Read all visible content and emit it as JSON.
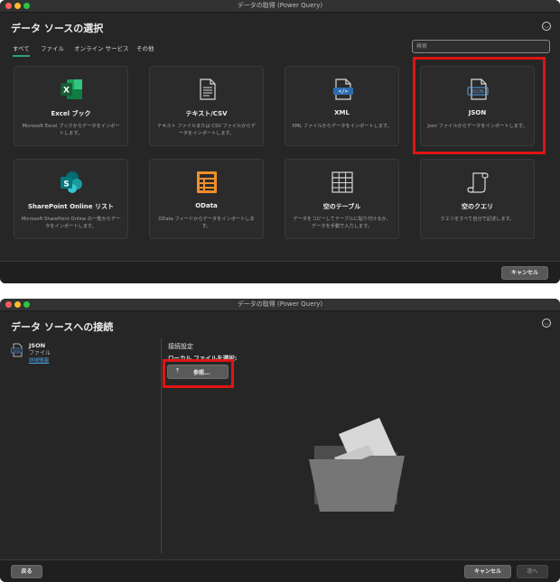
{
  "window1": {
    "title": "データの取得 (Power Query)",
    "heading": "データ ソースの選択",
    "tabs": [
      "すべて",
      "ファイル",
      "オンライン サービス",
      "その他"
    ],
    "active_tab": "すべて",
    "search_placeholder": "検索",
    "cards": [
      {
        "name": "Excel ブック",
        "desc": "Microsoft Excel ブックからデータをインポートします。",
        "icon": "excel-icon"
      },
      {
        "name": "テキスト/CSV",
        "desc": "テキスト ファイルまたは CSV ファイルからデータをインポートします。",
        "icon": "text-file-icon"
      },
      {
        "name": "XML",
        "desc": "XML ファイルからデータをインポートします。",
        "icon": "xml-file-icon"
      },
      {
        "name": "JSON",
        "desc": "Json ファイルからデータをインポートします。",
        "icon": "json-file-icon"
      },
      {
        "name": "SharePoint Online リスト",
        "desc": "Microsoft SharePoint Online の一覧からデータをインポートします。",
        "icon": "sharepoint-icon"
      },
      {
        "name": "OData",
        "desc": "OData フィードからデータをインポートします。",
        "icon": "odata-icon"
      },
      {
        "name": "空のテーブル",
        "desc": "データをコピーしてテーブルに貼り付けるか、データを手動で入力します。",
        "icon": "table-icon"
      },
      {
        "name": "空のクエリ",
        "desc": "クエリをすべて自分で記述します。",
        "icon": "scroll-icon"
      }
    ],
    "cancel_label": "キャンセル",
    "colors": {
      "highlight": "#e01414",
      "accent": "#2f9e7c"
    }
  },
  "window2": {
    "title": "データの取得 (Power Query)",
    "heading": "データ ソースへの接続",
    "source": {
      "name": "JSON",
      "type": "ファイル",
      "link": "詳細情報",
      "icon_text": "JSON"
    },
    "connection_settings": "接続設定",
    "local_file_label": "ローカル ファイルを選択:",
    "browse_label": "参照...",
    "back_label": "戻る",
    "cancel_label": "キャンセル",
    "next_label": "次へ"
  }
}
